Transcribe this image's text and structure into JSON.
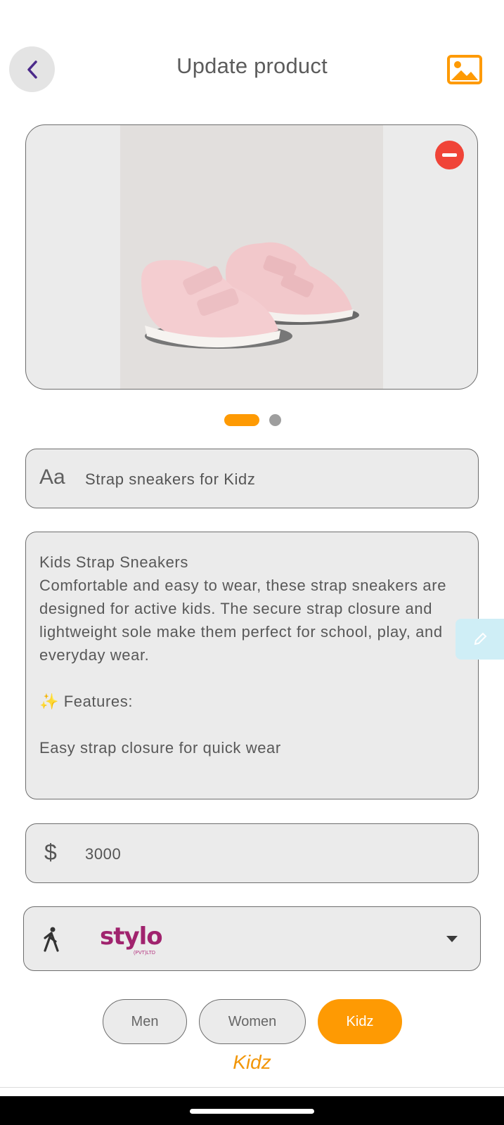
{
  "header": {
    "title": "Update product",
    "back_icon": "chevron-left-icon",
    "gallery_icon": "image-icon",
    "accent": "#fe9a03"
  },
  "images": {
    "count": 2,
    "active_index": 0,
    "remove_icon": "minus-circle-icon"
  },
  "name_field": {
    "icon": "Aa",
    "value": "Strap sneakers for Kidz"
  },
  "description_field": {
    "value": "Kids Strap Sneakers\nComfortable and easy to wear, these strap sneakers are designed for active kids. The secure strap closure and lightweight sole make them perfect for school, play, and everyday wear.\n\n✨ Features:\n\nEasy strap closure for quick wear"
  },
  "price_field": {
    "icon": "$",
    "value": "3000"
  },
  "brand_select": {
    "icon": "walking-person-icon",
    "selected_logo_text": "stylo",
    "selected_logo_subtext": "(PVT)LTD"
  },
  "categories": {
    "options": [
      "Men",
      "Women",
      "Kidz"
    ],
    "selected": "Kidz",
    "selected_label": "Kidz"
  }
}
